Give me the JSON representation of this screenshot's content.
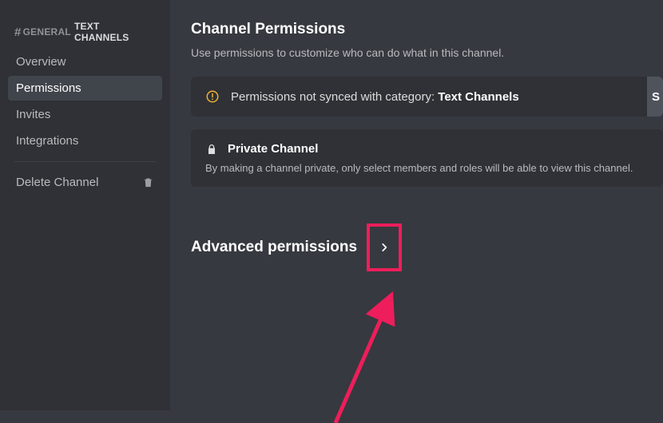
{
  "sidebar": {
    "hash": "#",
    "channel_name": "GENERAL",
    "category_name": "TEXT CHANNELS",
    "items": [
      {
        "label": "Overview"
      },
      {
        "label": "Permissions"
      },
      {
        "label": "Invites"
      },
      {
        "label": "Integrations"
      }
    ],
    "delete_label": "Delete Channel"
  },
  "page": {
    "title": "Channel Permissions",
    "subtitle": "Use permissions to customize who can do what in this channel."
  },
  "sync_notice": {
    "prefix": "Permissions not synced with category: ",
    "category": "Text Channels",
    "button_label": "S"
  },
  "private_card": {
    "title": "Private Channel",
    "description": "By making a channel private, only select members and roles will be able to view this channel."
  },
  "advanced": {
    "title": "Advanced permissions"
  }
}
